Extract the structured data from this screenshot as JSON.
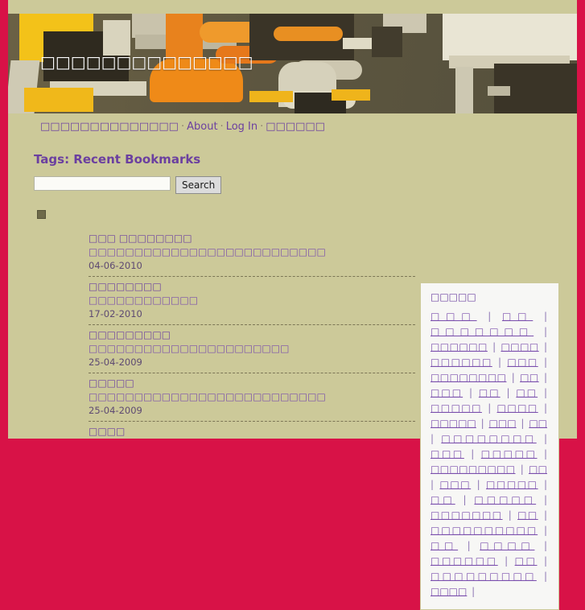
{
  "theme": {
    "frame_color": "#d81247",
    "page_bg": "#ccc999",
    "sidebar_bg": "#f7f7f5",
    "link_color": "#6b3fa0",
    "heading_color": "#6b3fa0",
    "divider_color": "#7c7656",
    "button_bg": "#dcdcdc"
  },
  "banner": {
    "title": "□□□□□□□□□□□□□□",
    "image_alt": "office-chairs-photo"
  },
  "nav": {
    "items": [
      {
        "label": "□□□□□□□□□□□□□□",
        "name": "nav-item-home"
      },
      {
        "label": "About",
        "name": "nav-item-about"
      },
      {
        "label": "Log In",
        "name": "nav-item-login"
      },
      {
        "label": "□□□□□□",
        "name": "nav-item-register"
      }
    ],
    "separator": "·"
  },
  "main": {
    "heading": "Tags: Recent Bookmarks",
    "search": {
      "value": "",
      "placeholder": "",
      "button_label": "Search"
    },
    "bookmarks": [
      {
        "title": "□□□ □□□□□□□□",
        "description": "□□□□□□□□□□□□□□□□□□□□□□□□□□",
        "date": "04-06-2010"
      },
      {
        "title": "□□□□□□□□",
        "description": "□□□□□□□□□□□□",
        "date": "17-02-2010"
      },
      {
        "title": "□□□□□□□□□",
        "description": "□□□□□□□□□□□□□□□□□□□□□□",
        "date": "25-04-2009"
      },
      {
        "title": "□□□□□",
        "description": "□□□□□□□□□□□□□□□□□□□□□□□□□□",
        "date": "25-04-2009"
      },
      {
        "title": "□□□□",
        "description": "",
        "date": ""
      }
    ]
  },
  "sidebar": {
    "heading": "□□□□□",
    "separator": "|",
    "tags": [
      "□□□",
      "□□",
      "□□□□□□□",
      "□□□□□□",
      "□□□□",
      "□□□□□□",
      "□□□",
      "□□□□□□□□",
      "□□",
      "□□□",
      "□□",
      "□□",
      "□□□□□",
      "□□□□",
      "□□□□□",
      "□□□",
      "□□",
      "□□□□□□□□",
      "□□□",
      "□□□□□",
      "□□□□□□□□□",
      "□□",
      "□□□",
      "□□□□□",
      "□□",
      "□□□□□",
      "□□□□□□□",
      "□□",
      "□□□□□□□□□□",
      "□□",
      "□□□□",
      "□□□□□□",
      "□□",
      "□□□□□□□□□",
      "□□□□"
    ]
  }
}
